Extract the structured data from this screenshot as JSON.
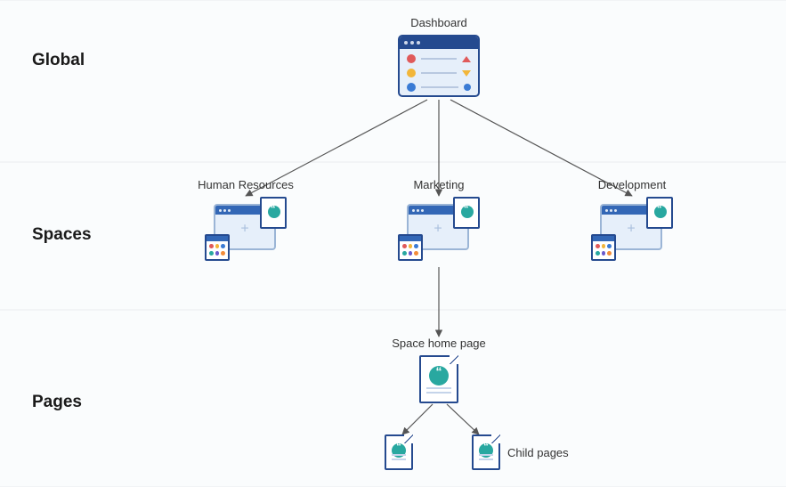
{
  "levels": {
    "global": "Global",
    "spaces": "Spaces",
    "pages": "Pages"
  },
  "dashboard": {
    "label": "Dashboard"
  },
  "spaces_nodes": [
    {
      "label": "Human Resources"
    },
    {
      "label": "Marketing"
    },
    {
      "label": "Development"
    }
  ],
  "home_page": {
    "label": "Space home page"
  },
  "child_pages": {
    "label": "Child pages"
  }
}
